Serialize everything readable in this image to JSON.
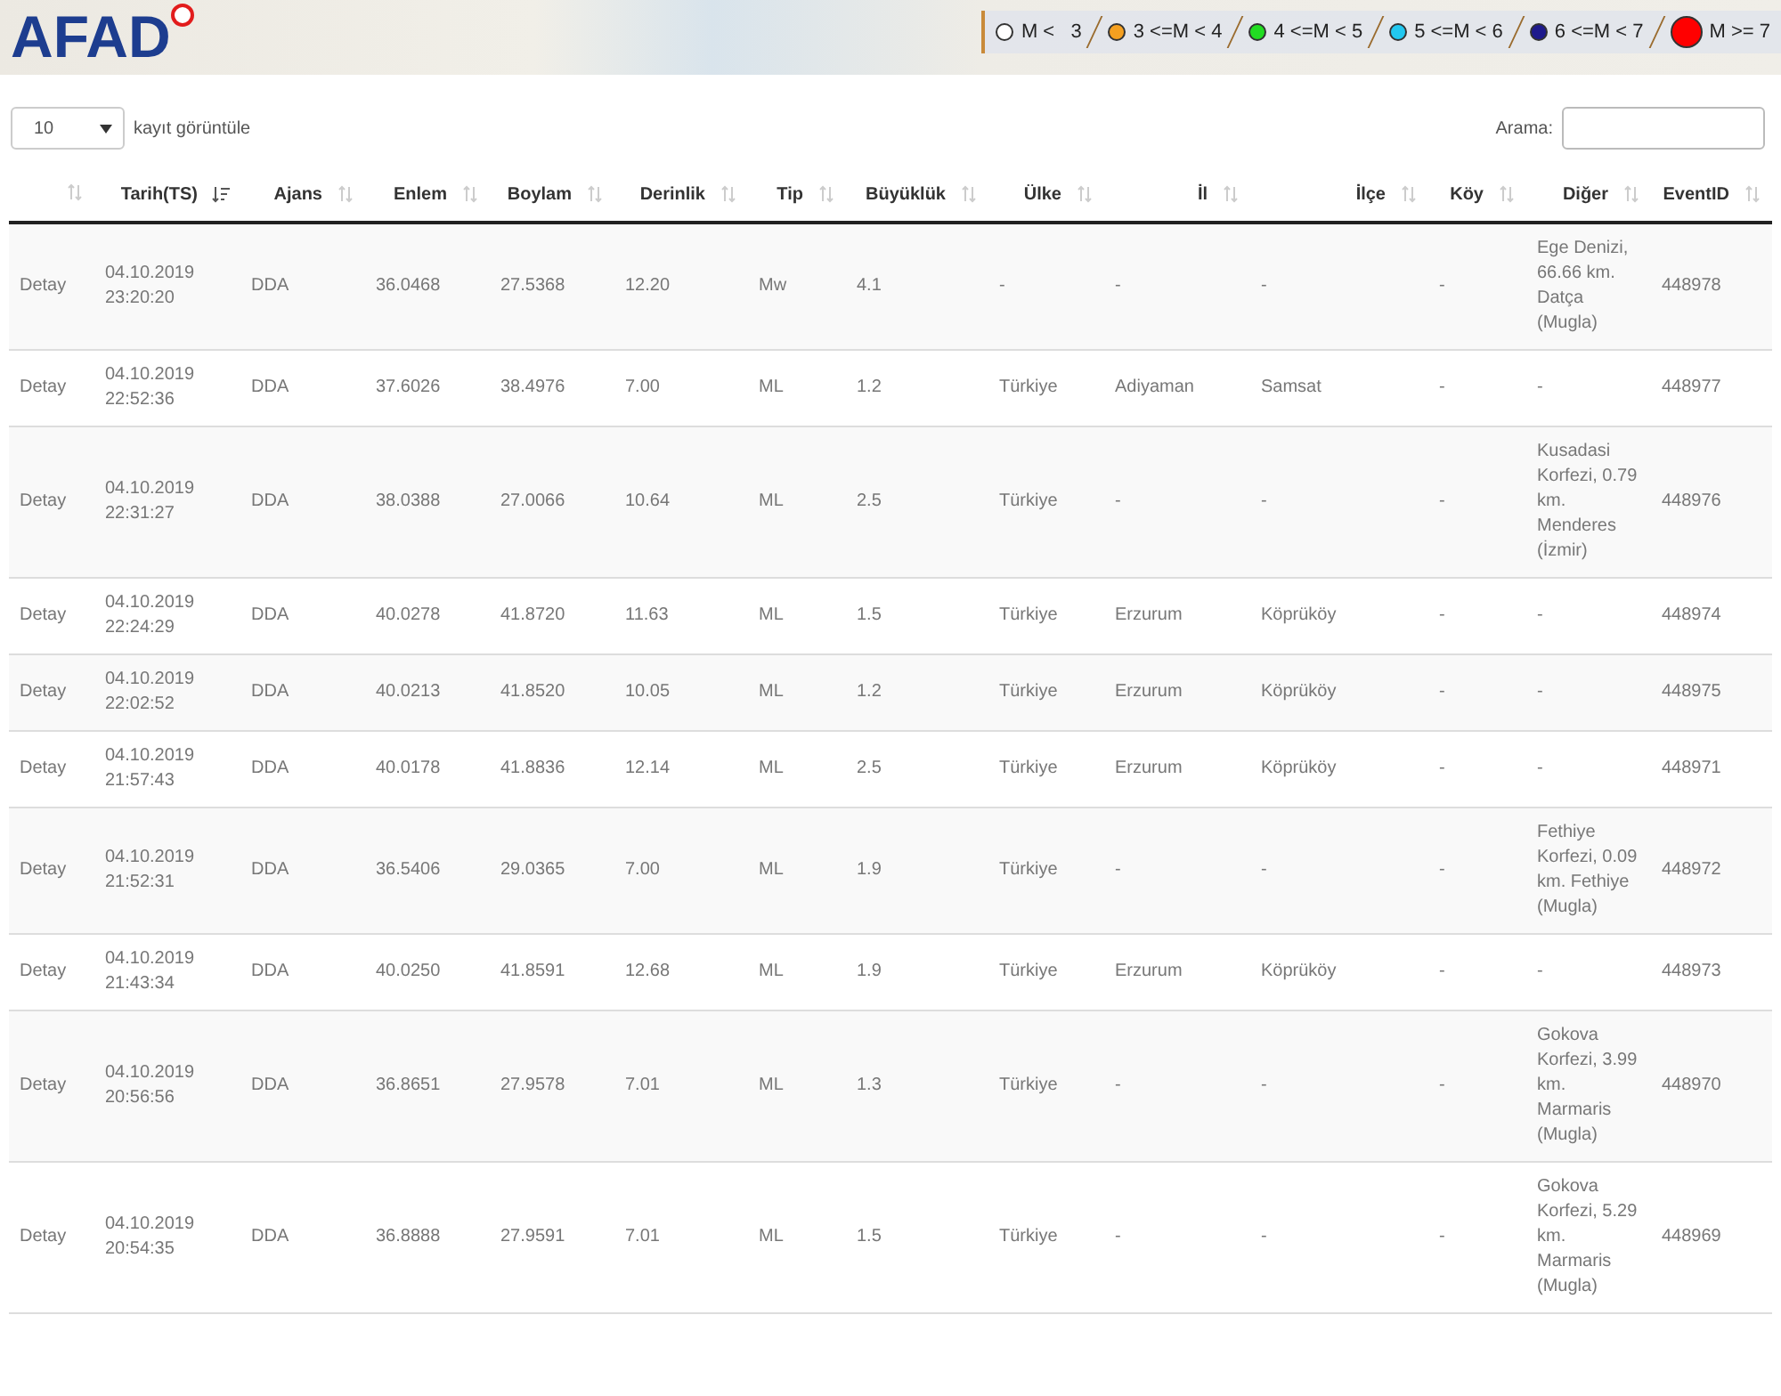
{
  "header": {
    "logo": "AFAD",
    "legend": [
      {
        "label": "M <   3",
        "color": "#ffffff"
      },
      {
        "label": "3 <=M < 4",
        "color": "#f5a020"
      },
      {
        "label": "4 <=M < 5",
        "color": "#22dd22"
      },
      {
        "label": "5 <=M < 6",
        "color": "#22c8f0"
      },
      {
        "label": "6 <=M < 7",
        "color": "#1e1a8c"
      },
      {
        "label": "M >= 7",
        "color": "#ff0000"
      }
    ]
  },
  "controls": {
    "page_size": "10",
    "page_size_label": "kayıt görüntüle",
    "search_label": "Arama:"
  },
  "table": {
    "columns": [
      {
        "sorted": false
      },
      {
        "label": "Tarih(TS)",
        "sorted": true
      },
      {
        "label": "Ajans",
        "sorted": false
      },
      {
        "label": "Enlem",
        "sorted": false
      },
      {
        "label": "Boylam",
        "sorted": false
      },
      {
        "label": "Derinlik",
        "sorted": false
      },
      {
        "label": "Tip",
        "sorted": false
      },
      {
        "label": "Büyüklük",
        "sorted": false
      },
      {
        "label": "Ülke",
        "sorted": false
      },
      {
        "label": "İl",
        "sorted": false
      },
      {
        "label": "İlçe",
        "sorted": false
      },
      {
        "label": "Köy",
        "sorted": false
      },
      {
        "label": "Diğer",
        "sorted": false
      },
      {
        "label": "EventID",
        "sorted": false
      }
    ],
    "rows": [
      [
        "Detay",
        "04.10.2019 23:20:20",
        "DDA",
        "36.0468",
        "27.5368",
        "12.20",
        "Mw",
        "4.1",
        "-",
        "-",
        "-",
        "-",
        "Ege Denizi, 66.66 km. Datça (Mugla)",
        "448978"
      ],
      [
        "Detay",
        "04.10.2019 22:52:36",
        "DDA",
        "37.6026",
        "38.4976",
        "7.00",
        "ML",
        "1.2",
        "Türkiye",
        "Adiyaman",
        "Samsat",
        "-",
        "-",
        "448977"
      ],
      [
        "Detay",
        "04.10.2019 22:31:27",
        "DDA",
        "38.0388",
        "27.0066",
        "10.64",
        "ML",
        "2.5",
        "Türkiye",
        "-",
        "-",
        "-",
        "Kusadasi Korfezi, 0.79 km. Menderes (İzmir)",
        "448976"
      ],
      [
        "Detay",
        "04.10.2019 22:24:29",
        "DDA",
        "40.0278",
        "41.8720",
        "11.63",
        "ML",
        "1.5",
        "Türkiye",
        "Erzurum",
        "Köprüköy",
        "-",
        "-",
        "448974"
      ],
      [
        "Detay",
        "04.10.2019 22:02:52",
        "DDA",
        "40.0213",
        "41.8520",
        "10.05",
        "ML",
        "1.2",
        "Türkiye",
        "Erzurum",
        "Köprüköy",
        "-",
        "-",
        "448975"
      ],
      [
        "Detay",
        "04.10.2019 21:57:43",
        "DDA",
        "40.0178",
        "41.8836",
        "12.14",
        "ML",
        "2.5",
        "Türkiye",
        "Erzurum",
        "Köprüköy",
        "-",
        "-",
        "448971"
      ],
      [
        "Detay",
        "04.10.2019 21:52:31",
        "DDA",
        "36.5406",
        "29.0365",
        "7.00",
        "ML",
        "1.9",
        "Türkiye",
        "-",
        "-",
        "-",
        "Fethiye Korfezi, 0.09 km. Fethiye (Mugla)",
        "448972"
      ],
      [
        "Detay",
        "04.10.2019 21:43:34",
        "DDA",
        "40.0250",
        "41.8591",
        "12.68",
        "ML",
        "1.9",
        "Türkiye",
        "Erzurum",
        "Köprüköy",
        "-",
        "-",
        "448973"
      ],
      [
        "Detay",
        "04.10.2019 20:56:56",
        "DDA",
        "36.8651",
        "27.9578",
        "7.01",
        "ML",
        "1.3",
        "Türkiye",
        "-",
        "-",
        "-",
        "Gokova Korfezi, 3.99 km. Marmaris (Mugla)",
        "448970"
      ],
      [
        "Detay",
        "04.10.2019 20:54:35",
        "DDA",
        "36.8888",
        "27.9591",
        "7.01",
        "ML",
        "1.5",
        "Türkiye",
        "-",
        "-",
        "-",
        "Gokova Korfezi, 5.29 km. Marmaris (Mugla)",
        "448969"
      ]
    ]
  }
}
